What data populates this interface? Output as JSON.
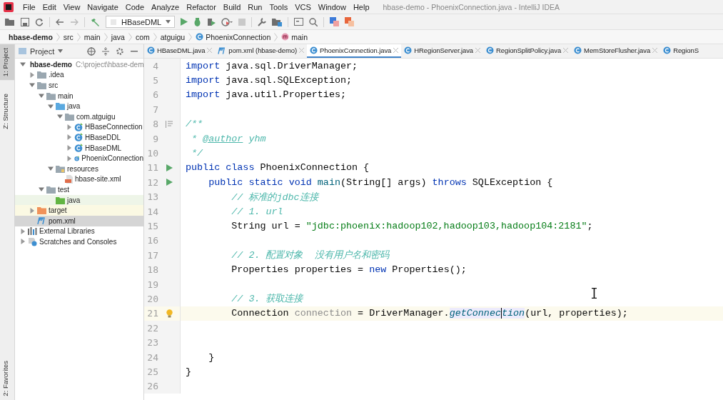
{
  "menu": [
    "File",
    "Edit",
    "View",
    "Navigate",
    "Code",
    "Analyze",
    "Refactor",
    "Build",
    "Run",
    "Tools",
    "VCS",
    "Window",
    "Help"
  ],
  "window": {
    "title": "hbase-demo - PhoenixConnection.java - IntelliJ IDEA"
  },
  "toolbar": {
    "run_config": "HBaseDML"
  },
  "breadcrumbs": [
    {
      "label": "hbase-demo",
      "kind": "module"
    },
    {
      "label": "src",
      "kind": "plain"
    },
    {
      "label": "main",
      "kind": "plain"
    },
    {
      "label": "java",
      "kind": "plain"
    },
    {
      "label": "com",
      "kind": "plain"
    },
    {
      "label": "atguigu",
      "kind": "plain"
    },
    {
      "label": "PhoenixConnection",
      "kind": "class"
    },
    {
      "label": "main",
      "kind": "method"
    }
  ],
  "tool_tabs": {
    "top": [
      {
        "label": "1: Project",
        "selected": true
      },
      {
        "label": "Z: Structure",
        "selected": false
      }
    ],
    "bottom": [
      {
        "label": "2: Favorites",
        "selected": false
      }
    ]
  },
  "project": {
    "title": "Project",
    "tree": [
      {
        "label": "hbase-demo",
        "path": "C:\\project\\hbase-dem",
        "kind": "module",
        "expanded": true,
        "selected": false,
        "children": [
          {
            "label": ".idea",
            "kind": "folder",
            "expanded": false,
            "selected": false
          },
          {
            "label": "src",
            "kind": "folder",
            "expanded": true,
            "selected": false,
            "children": [
              {
                "label": "main",
                "kind": "folder",
                "expanded": true,
                "selected": false,
                "children": [
                  {
                    "label": "java",
                    "kind": "source",
                    "expanded": true,
                    "selected": false,
                    "children": [
                      {
                        "label": "com.atguigu",
                        "kind": "package",
                        "expanded": true,
                        "selected": false,
                        "children": [
                          {
                            "label": "HBaseConnection",
                            "kind": "class",
                            "expanded": false,
                            "selected": false
                          },
                          {
                            "label": "HBaseDDL",
                            "kind": "class",
                            "expanded": false,
                            "selected": false
                          },
                          {
                            "label": "HBaseDML",
                            "kind": "class",
                            "expanded": false,
                            "selected": false
                          },
                          {
                            "label": "PhoenixConnection",
                            "kind": "class",
                            "expanded": false,
                            "selected": false
                          }
                        ]
                      }
                    ]
                  },
                  {
                    "label": "resources",
                    "kind": "resources",
                    "expanded": true,
                    "selected": false,
                    "children": [
                      {
                        "label": "hbase-site.xml",
                        "kind": "xml",
                        "selected": false
                      }
                    ]
                  }
                ]
              },
              {
                "label": "test",
                "kind": "folder",
                "expanded": true,
                "selected": false,
                "children": [
                  {
                    "label": "java",
                    "kind": "test",
                    "selected": false,
                    "color": "#eef5e8"
                  }
                ]
              }
            ]
          },
          {
            "label": "target",
            "kind": "target",
            "expanded": false,
            "selected": false,
            "color": "#fbf9e3"
          },
          {
            "label": "pom.xml",
            "kind": "maven",
            "selected": true
          }
        ]
      },
      {
        "label": "External Libraries",
        "kind": "libraries",
        "expanded": false,
        "selected": false
      },
      {
        "label": "Scratches and Consoles",
        "kind": "scratches",
        "expanded": false,
        "selected": false
      }
    ]
  },
  "tabs": [
    {
      "label": "HBaseDML.java",
      "kind": "class",
      "selected": false
    },
    {
      "label": "pom.xml (hbase-demo)",
      "kind": "maven",
      "selected": false
    },
    {
      "label": "PhoenixConnection.java",
      "kind": "class",
      "selected": true
    },
    {
      "label": "HRegionServer.java",
      "kind": "class",
      "selected": false
    },
    {
      "label": "RegionSplitPolicy.java",
      "kind": "class",
      "selected": false
    },
    {
      "label": "MemStoreFlusher.java",
      "kind": "class",
      "selected": false
    },
    {
      "label": "RegionS",
      "kind": "class",
      "selected": false
    }
  ],
  "code": [
    {
      "num": "4",
      "current": false,
      "kind": "plain",
      "tokens": [
        {
          "kind": "kw",
          "text": "import "
        },
        {
          "kind": "plain",
          "text": "java.sql.DriverManager;"
        }
      ]
    },
    {
      "num": "5",
      "current": false,
      "kind": "plain",
      "tokens": [
        {
          "kind": "kw",
          "text": "import "
        },
        {
          "kind": "plain",
          "text": "java.sql.SQLException;"
        }
      ]
    },
    {
      "num": "6",
      "current": false,
      "kind": "plain",
      "tokens": [
        {
          "kind": "kw",
          "text": "import "
        },
        {
          "kind": "plain",
          "text": "java.util.Properties;"
        }
      ]
    },
    {
      "num": "7",
      "current": false,
      "kind": "plain"
    },
    {
      "num": "8",
      "current": false,
      "kind": "doc",
      "tokens": [
        {
          "kind": "doc",
          "text": "/**"
        }
      ]
    },
    {
      "num": "9",
      "current": false,
      "kind": "plain",
      "tokens": [
        {
          "kind": "doc",
          "text": " * "
        },
        {
          "kind": "doctag",
          "text": "@author"
        },
        {
          "kind": "doc",
          "text": " yhm"
        }
      ]
    },
    {
      "num": "10",
      "current": false,
      "kind": "plain",
      "tokens": [
        {
          "kind": "doc",
          "text": " */"
        }
      ]
    },
    {
      "num": "11",
      "current": false,
      "kind": "run",
      "tokens": [
        {
          "kind": "kw",
          "text": "public class "
        },
        {
          "kind": "plain",
          "text": "PhoenixConnection {"
        }
      ]
    },
    {
      "num": "12",
      "current": false,
      "kind": "run",
      "tokens": [
        {
          "kind": "kw",
          "text": "    public static void "
        },
        {
          "kind": "decl",
          "text": "main"
        },
        {
          "kind": "plain",
          "text": "(String[] args) "
        },
        {
          "kind": "kw",
          "text": "throws "
        },
        {
          "kind": "plain",
          "text": "SQLException {"
        }
      ]
    },
    {
      "num": "13",
      "current": false,
      "kind": "plain",
      "tokens": [
        {
          "kind": "comment",
          "text": "        // 标准的jdbc连接"
        }
      ]
    },
    {
      "num": "14",
      "current": false,
      "kind": "plain",
      "tokens": [
        {
          "kind": "comment",
          "text": "        // 1. url"
        }
      ]
    },
    {
      "num": "15",
      "current": false,
      "kind": "plain",
      "tokens": [
        {
          "kind": "plain",
          "text": "        String url = "
        },
        {
          "kind": "str",
          "text": "\"jdbc:phoenix:hadoop102,hadoop103,hadoop104:2181\""
        },
        {
          "kind": "plain",
          "text": ";"
        }
      ]
    },
    {
      "num": "16",
      "current": false,
      "kind": "plain"
    },
    {
      "num": "17",
      "current": false,
      "kind": "plain",
      "tokens": [
        {
          "kind": "comment",
          "text": "        // 2. 配置对象  没有用户名和密码"
        }
      ]
    },
    {
      "num": "18",
      "current": false,
      "kind": "plain",
      "tokens": [
        {
          "kind": "plain",
          "text": "        Properties properties = "
        },
        {
          "kind": "kw",
          "text": "new "
        },
        {
          "kind": "plain",
          "text": "Properties();"
        }
      ]
    },
    {
      "num": "19",
      "current": false,
      "kind": "plain"
    },
    {
      "num": "20",
      "current": false,
      "kind": "plain",
      "tokens": [
        {
          "kind": "comment",
          "text": "        // 3. 获取连接"
        }
      ]
    },
    {
      "num": "21",
      "current": true,
      "kind": "bulb",
      "tokens": [
        {
          "kind": "plain",
          "text": "        Connection "
        },
        {
          "kind": "unused",
          "text": "connection"
        },
        {
          "kind": "plain",
          "text": " = DriverManager."
        },
        {
          "kind": "method",
          "text": "getConnec"
        },
        {
          "kind": "caret"
        },
        {
          "kind": "method",
          "text": "tion"
        },
        {
          "kind": "plain",
          "text": "(url, properties);"
        }
      ]
    },
    {
      "num": "22",
      "current": false,
      "kind": "plain"
    },
    {
      "num": "23",
      "current": false,
      "kind": "plain"
    },
    {
      "num": "24",
      "current": false,
      "kind": "plain",
      "tokens": [
        {
          "kind": "plain",
          "text": "    }"
        }
      ]
    },
    {
      "num": "25",
      "current": false,
      "kind": "plain",
      "tokens": [
        {
          "kind": "plain",
          "text": "}"
        }
      ]
    },
    {
      "num": "26",
      "current": false,
      "kind": "plain"
    }
  ]
}
